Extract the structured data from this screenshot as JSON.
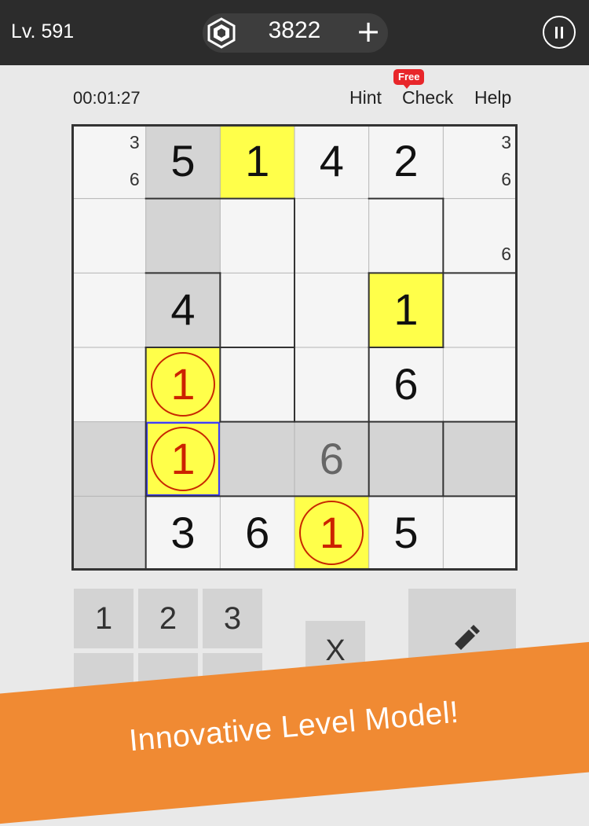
{
  "header": {
    "level_label": "Lv. 591",
    "coin_count": "3822",
    "add_coins_label": "+",
    "coin_icon": "hexagon-coin-icon",
    "pause_icon": "pause-icon"
  },
  "toolbar": {
    "timer": "00:01:27",
    "hint_label": "Hint",
    "check_label": "Check",
    "check_badge": "Free",
    "help_label": "Help"
  },
  "colors": {
    "topbar": "#2c2c2c",
    "highlight_yellow": "#ffff4a",
    "shaded_gray": "#d4d4d4",
    "empty_cell": "#f5f5f5",
    "circle_red": "#c82800",
    "selection_blue": "#3333ff",
    "banner_orange": "#f08a33"
  },
  "board": {
    "size": 6,
    "rows": [
      [
        {
          "shade": "white",
          "notes": [
            "3",
            "6"
          ]
        },
        {
          "shade": "gray",
          "value": "5"
        },
        {
          "shade": "yellow",
          "value": "1"
        },
        {
          "shade": "white",
          "value": "4"
        },
        {
          "shade": "white",
          "value": "2"
        },
        {
          "shade": "white",
          "notes": [
            "3",
            "6"
          ]
        }
      ],
      [
        {
          "shade": "white"
        },
        {
          "shade": "gray"
        },
        {
          "shade": "white"
        },
        {
          "shade": "white"
        },
        {
          "shade": "white"
        },
        {
          "shade": "white",
          "notes": [
            "",
            "6"
          ]
        }
      ],
      [
        {
          "shade": "white"
        },
        {
          "shade": "gray",
          "value": "4"
        },
        {
          "shade": "white"
        },
        {
          "shade": "white"
        },
        {
          "shade": "yellow",
          "value": "1"
        },
        {
          "shade": "white"
        }
      ],
      [
        {
          "shade": "white"
        },
        {
          "shade": "yellow",
          "value": "1",
          "circled": true
        },
        {
          "shade": "white"
        },
        {
          "shade": "white"
        },
        {
          "shade": "white",
          "value": "6"
        },
        {
          "shade": "white"
        }
      ],
      [
        {
          "shade": "gray"
        },
        {
          "shade": "yellow",
          "value": "1",
          "circled": true,
          "selected": true
        },
        {
          "shade": "gray"
        },
        {
          "shade": "gray",
          "value": "6",
          "pencil": true
        },
        {
          "shade": "gray"
        },
        {
          "shade": "gray"
        }
      ],
      [
        {
          "shade": "gray"
        },
        {
          "shade": "white",
          "value": "3"
        },
        {
          "shade": "white",
          "value": "6"
        },
        {
          "shade": "yellow",
          "value": "1",
          "circled": true
        },
        {
          "shade": "white",
          "value": "5"
        },
        {
          "shade": "white"
        }
      ]
    ]
  },
  "keypad": {
    "keys": [
      "1",
      "2",
      "3"
    ],
    "erase_label": "X",
    "pencil_icon": "pencil-icon"
  },
  "banner": {
    "text": "Innovative Level Model!"
  }
}
